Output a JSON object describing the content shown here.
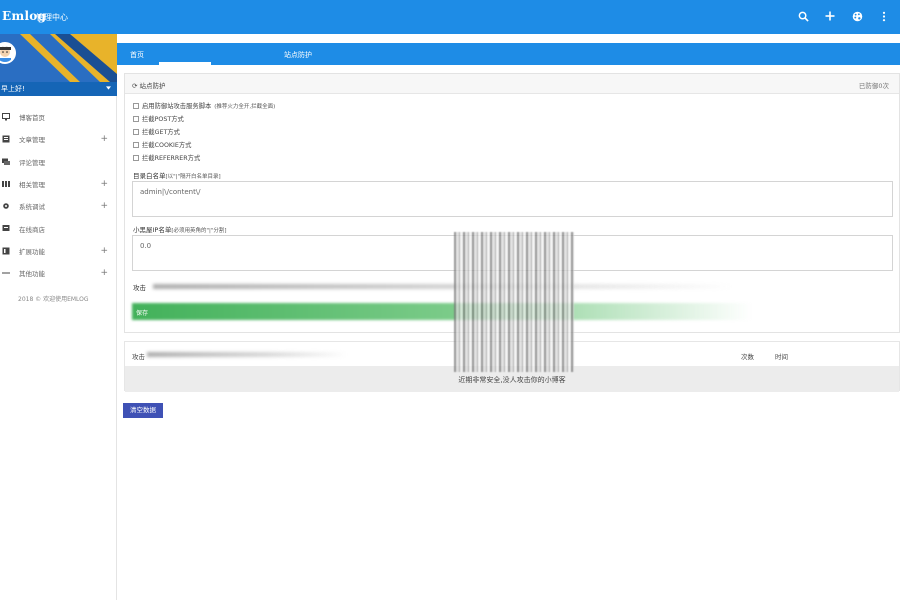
{
  "topbar": {
    "brand": "Emlog",
    "subtitle": "管理中心",
    "icons": [
      "search-icon",
      "plus-icon",
      "palette-icon",
      "more-vert-icon"
    ]
  },
  "sidebar": {
    "user": "早上好!",
    "items": [
      {
        "label": "博客首页",
        "icon": "monitor-icon",
        "expandable": false
      },
      {
        "label": "文章管理",
        "icon": "article-icon",
        "expandable": true
      },
      {
        "label": "评论管理",
        "icon": "comment-icon",
        "expandable": false
      },
      {
        "label": "相关管理",
        "icon": "grid-icon",
        "expandable": true
      },
      {
        "label": "系统调试",
        "icon": "gear-icon",
        "expandable": true
      },
      {
        "label": "在线商店",
        "icon": "store-icon",
        "expandable": false
      },
      {
        "label": "扩展功能",
        "icon": "extension-icon",
        "expandable": true
      },
      {
        "label": "其他功能",
        "icon": "more-horiz-icon",
        "expandable": true
      }
    ],
    "footer": "2018 © 欢迎使用EMLOG"
  },
  "tabs": [
    {
      "label": "首页",
      "active": false
    },
    {
      "label": "站点防护",
      "active": true
    }
  ],
  "panel": {
    "title": "站点防护",
    "status": "已防御0次",
    "options": [
      {
        "label": "启用防御站攻击服务脚本",
        "note": "(推荐火力全开,拦截全面)",
        "checked": false
      },
      {
        "label": "拦截POST方式",
        "checked": false
      },
      {
        "label": "拦截GET方式",
        "checked": false
      },
      {
        "label": "拦截COOKIE方式",
        "checked": false
      },
      {
        "label": "拦截REFERRER方式",
        "checked": false
      }
    ],
    "whitelist_label": "目录白名单",
    "whitelist_note": "[以\"|\"隔开白名单目录]",
    "whitelist_value": "admin|\\/content\\/",
    "blacklist_label": "小黑屋IP名单",
    "blacklist_note": "[必须用英角的\"|\"分割]",
    "blacklist_value": "0.0",
    "attack_label": "攻击",
    "save_label": "保存"
  },
  "table": {
    "columns": [
      "攻击",
      "次数",
      "时间"
    ],
    "empty_message": "近期非常安全,没人攻击你的小博客"
  },
  "clear_button": "清空数据",
  "colors": {
    "primary": "#1e8ce6",
    "accent_button": "#3f51b5",
    "success": "#42b15a"
  }
}
